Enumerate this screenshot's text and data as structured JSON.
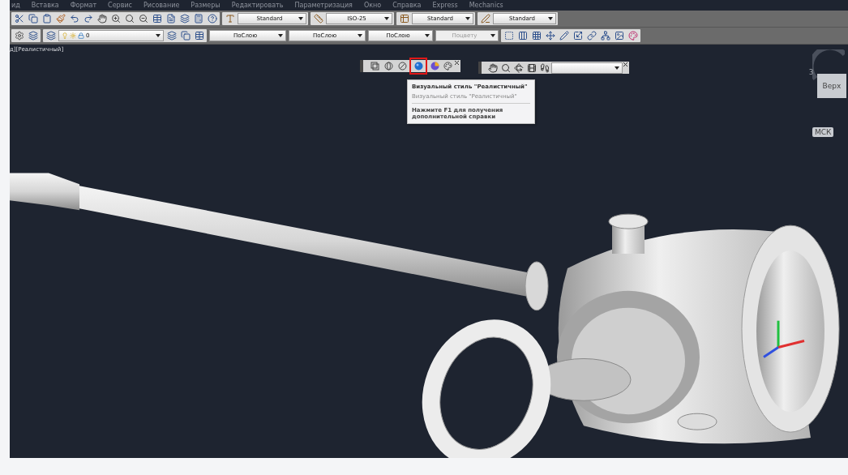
{
  "menu": [
    "ид",
    "Вставка",
    "Формат",
    "Сервис",
    "Рисование",
    "Размеры",
    "Редактировать",
    "Параметризация",
    "Окно",
    "Справка",
    "Express",
    "Mechanics"
  ],
  "toolbar_1": {
    "combos": [
      {
        "value": "Standard",
        "disabled": false
      },
      {
        "value": "ISO-25",
        "disabled": false
      },
      {
        "value": "Standard",
        "disabled": false
      },
      {
        "value": "Standard",
        "disabled": false
      }
    ]
  },
  "toolbar_2": {
    "layer": {
      "value": "0"
    },
    "combos": [
      {
        "value": "ПоСлою",
        "disabled": false
      },
      {
        "value": "ПоСлою",
        "disabled": false
      },
      {
        "value": "ПоСлою",
        "disabled": false
      },
      {
        "value": "Поцвету",
        "disabled": true
      }
    ]
  },
  "viewport": {
    "label": "д][Реалистичный]",
    "visual_styles": [
      {
        "kind": "wireframe2d",
        "selected": false
      },
      {
        "kind": "wireframe3d",
        "selected": false
      },
      {
        "kind": "hidden",
        "selected": false
      },
      {
        "kind": "realistic",
        "selected": true
      },
      {
        "kind": "conceptual",
        "selected": false
      }
    ],
    "tooltip": {
      "title": "Визуальный стиль \"Реалистичный\"",
      "subtitle": "Визуальный стиль \"Реалистичный\"",
      "hint": "Нажмите F1 для получения дополнительной справки"
    },
    "viewcube": {
      "west": "З",
      "face": "Верх",
      "ucs": "МСК"
    }
  }
}
